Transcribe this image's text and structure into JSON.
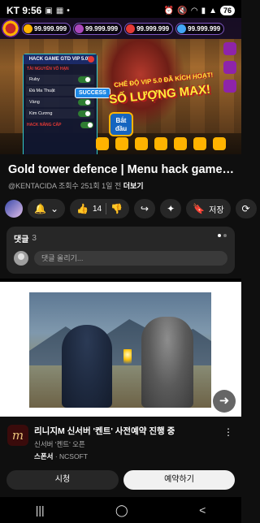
{
  "status_bar": {
    "carrier_time": "KT 9:56",
    "battery": "76"
  },
  "video": {
    "game": {
      "resources": [
        "99.999.999",
        "99.999.999",
        "99.999.999",
        "99.999.999"
      ],
      "menu_title": "HACK GAME GTD VIP 5.0V",
      "menu_subtitle": "TÀI NGUYÊN VÔ HẠN",
      "menu_rows": [
        "Ruby",
        "Đá Ma Thuật",
        "Vàng",
        "Kim Cương"
      ],
      "menu_footer": "HACK NÂNG CẤP",
      "success": "SUCCESS",
      "banner_line1": "CHẾ ĐỘ VIP 5.0 ĐÃ KÍCH HOẠT!",
      "banner_line2": "SỐ LƯỢNG MAX!",
      "start_label": "Bắt đầu"
    }
  },
  "title": "Gold tower defence | Menu hack game đã chính...",
  "meta": {
    "channel": "@KENTACIDA",
    "views": "조회수 251회",
    "age": "1일 전",
    "more": "더보기"
  },
  "actions": {
    "likes": "14",
    "save": "저장"
  },
  "comments": {
    "label": "댓글",
    "count": "3",
    "placeholder": "댓글 올리기..."
  },
  "ad": {
    "logo": "m",
    "title": "리니지M 신서버 '켄트' 사전예약 진행 중",
    "subtitle": "신서버 '켄트' 오픈",
    "sponsor_label": "스폰서",
    "sponsor_name": "NCSOFT",
    "watch": "시청",
    "reserve": "예약하기"
  },
  "colors": {
    "background": "#0f0f0f",
    "pill": "#272727",
    "accent_light": "#f1f1f1"
  }
}
